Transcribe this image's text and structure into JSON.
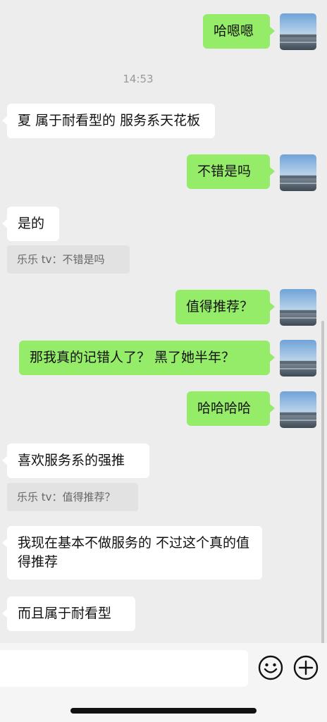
{
  "messages": [
    {
      "side": "out",
      "text": "哈嗯嗯"
    },
    {
      "side": "time",
      "text": "14:53"
    },
    {
      "side": "in",
      "text": "夏 属于耐看型的 服务系天花板"
    },
    {
      "side": "out",
      "text": "不错是吗"
    },
    {
      "side": "in",
      "text": "是的",
      "quote": "乐乐 tv：不错是吗"
    },
    {
      "side": "out",
      "text": "值得推荐？"
    },
    {
      "side": "out",
      "text": "那我真的记错人了？ 黑了她半年？"
    },
    {
      "side": "out",
      "text": "哈哈哈哈"
    },
    {
      "side": "in",
      "text": "喜欢服务系的强推",
      "quote": "乐乐 tv：值得推荐？"
    },
    {
      "side": "in",
      "text": "我现在基本不做服务的 不过这个真的值得推荐"
    },
    {
      "side": "in",
      "text": "而且属于耐看型"
    }
  ],
  "colors": {
    "outgoing": "#95ec69",
    "incoming": "#ffffff",
    "background": "#ededed"
  },
  "input_bar": {
    "emoji_icon": "emoji-icon",
    "plus_icon": "plus-icon"
  }
}
